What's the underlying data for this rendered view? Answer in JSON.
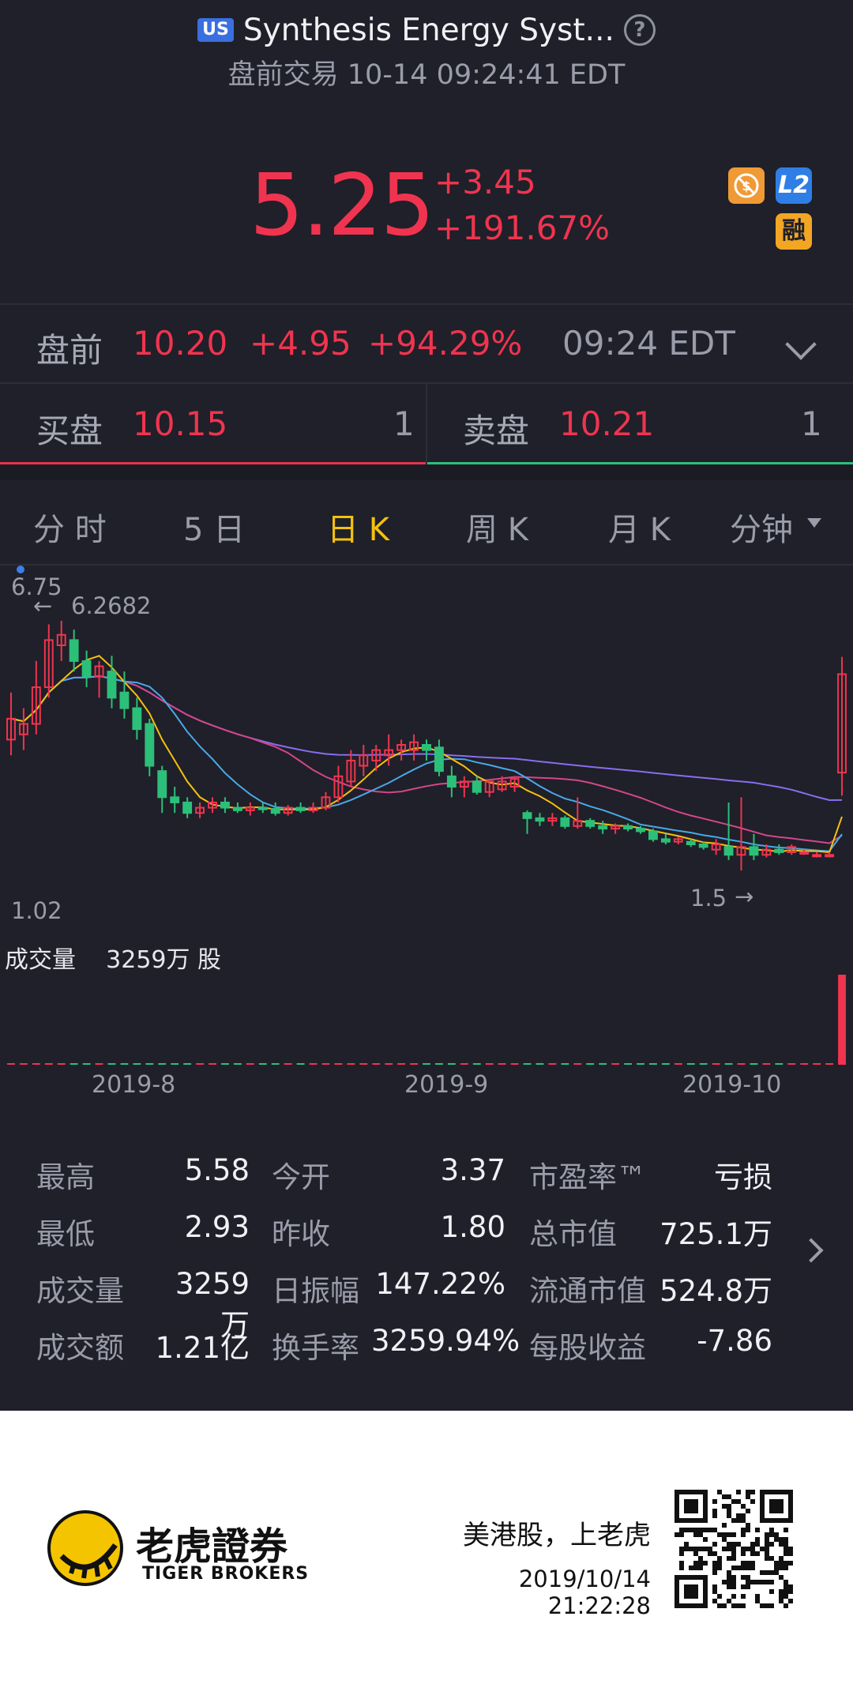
{
  "header": {
    "market_badge": "US",
    "title": "Synthesis Energy Syst...",
    "help_icon": "question-circle-icon",
    "subtitle": "盘前交易 10-14 09:24:41 EDT"
  },
  "quote": {
    "price": "5.25",
    "change": "+3.45",
    "change_pct": "+191.67%",
    "color_up": "#f0344f",
    "badges": {
      "nofee_icon": "no-commission-icon",
      "l2": "L2",
      "margin": "融"
    }
  },
  "premarket": {
    "label": "盘前",
    "price": "10.20",
    "change": "+4.95",
    "change_pct": "+94.29%",
    "time": "09:24 EDT"
  },
  "orderbook": {
    "bid_label": "买盘",
    "bid_price": "10.15",
    "bid_size": "1",
    "ask_label": "卖盘",
    "ask_price": "10.21",
    "ask_size": "1"
  },
  "tabs": [
    {
      "label": "分 时"
    },
    {
      "label": "5 日"
    },
    {
      "label": "日 K"
    },
    {
      "label": "周 K"
    },
    {
      "label": "月 K"
    },
    {
      "label": "分钟"
    }
  ],
  "active_tab": 2,
  "chart_data": {
    "type": "candlestick",
    "y_max_label": "6.75",
    "y_min_label": "1.02",
    "high_marker": "6.2682",
    "low_marker": "1.5",
    "volume_label": "成交量",
    "volume_value": "3259万 股",
    "x_labels": [
      "2019-8",
      "2019-9",
      "2019-10"
    ],
    "ylim": [
      1.02,
      6.75
    ],
    "colors": {
      "up": "#f0344f",
      "down": "#2cbf79",
      "ma5": "#f4c10e",
      "ma10": "#4aa8e8",
      "ma20": "#d5458c",
      "ma60": "#8a6cf0"
    },
    "candles": [
      {
        "o": 4.0,
        "h": 4.9,
        "l": 3.7,
        "c": 4.4
      },
      {
        "o": 4.1,
        "h": 4.6,
        "l": 3.8,
        "c": 4.3
      },
      {
        "o": 4.3,
        "h": 5.5,
        "l": 4.1,
        "c": 5.0
      },
      {
        "o": 5.0,
        "h": 6.2,
        "l": 4.8,
        "c": 5.9
      },
      {
        "o": 5.8,
        "h": 6.27,
        "l": 5.5,
        "c": 6.0
      },
      {
        "o": 5.9,
        "h": 6.1,
        "l": 5.3,
        "c": 5.5
      },
      {
        "o": 5.5,
        "h": 5.7,
        "l": 5.0,
        "c": 5.2
      },
      {
        "o": 5.2,
        "h": 5.5,
        "l": 4.8,
        "c": 5.4
      },
      {
        "o": 5.3,
        "h": 5.6,
        "l": 4.6,
        "c": 4.8
      },
      {
        "o": 4.9,
        "h": 5.3,
        "l": 4.4,
        "c": 4.6
      },
      {
        "o": 4.6,
        "h": 4.8,
        "l": 4.0,
        "c": 4.2
      },
      {
        "o": 4.3,
        "h": 4.4,
        "l": 3.3,
        "c": 3.5
      },
      {
        "o": 3.4,
        "h": 3.5,
        "l": 2.6,
        "c": 2.9
      },
      {
        "o": 2.9,
        "h": 3.1,
        "l": 2.6,
        "c": 2.8
      },
      {
        "o": 2.8,
        "h": 2.9,
        "l": 2.5,
        "c": 2.6
      },
      {
        "o": 2.6,
        "h": 2.8,
        "l": 2.5,
        "c": 2.7
      },
      {
        "o": 2.7,
        "h": 2.9,
        "l": 2.6,
        "c": 2.8
      },
      {
        "o": 2.8,
        "h": 2.9,
        "l": 2.6,
        "c": 2.7
      },
      {
        "o": 2.7,
        "h": 2.8,
        "l": 2.6,
        "c": 2.65
      },
      {
        "o": 2.65,
        "h": 2.8,
        "l": 2.55,
        "c": 2.7
      },
      {
        "o": 2.7,
        "h": 2.8,
        "l": 2.6,
        "c": 2.68
      },
      {
        "o": 2.68,
        "h": 2.8,
        "l": 2.55,
        "c": 2.6
      },
      {
        "o": 2.6,
        "h": 2.75,
        "l": 2.55,
        "c": 2.7
      },
      {
        "o": 2.7,
        "h": 2.8,
        "l": 2.6,
        "c": 2.65
      },
      {
        "o": 2.65,
        "h": 2.8,
        "l": 2.6,
        "c": 2.7
      },
      {
        "o": 2.7,
        "h": 3.0,
        "l": 2.65,
        "c": 2.9
      },
      {
        "o": 2.9,
        "h": 3.5,
        "l": 2.8,
        "c": 3.3
      },
      {
        "o": 3.2,
        "h": 3.8,
        "l": 3.1,
        "c": 3.6
      },
      {
        "o": 3.5,
        "h": 3.9,
        "l": 3.3,
        "c": 3.7
      },
      {
        "o": 3.6,
        "h": 3.9,
        "l": 3.4,
        "c": 3.8
      },
      {
        "o": 3.7,
        "h": 4.1,
        "l": 3.5,
        "c": 3.8
      },
      {
        "o": 3.8,
        "h": 4.0,
        "l": 3.6,
        "c": 3.9
      },
      {
        "o": 3.8,
        "h": 4.1,
        "l": 3.6,
        "c": 3.95
      },
      {
        "o": 3.9,
        "h": 4.0,
        "l": 3.6,
        "c": 3.8
      },
      {
        "o": 3.85,
        "h": 4.0,
        "l": 3.3,
        "c": 3.4
      },
      {
        "o": 3.3,
        "h": 3.5,
        "l": 2.9,
        "c": 3.1
      },
      {
        "o": 3.1,
        "h": 3.3,
        "l": 2.9,
        "c": 3.2
      },
      {
        "o": 3.2,
        "h": 3.3,
        "l": 2.95,
        "c": 3.0
      },
      {
        "o": 3.0,
        "h": 3.25,
        "l": 2.9,
        "c": 3.2
      },
      {
        "o": 3.05,
        "h": 3.3,
        "l": 3.0,
        "c": 3.2
      },
      {
        "o": 3.1,
        "h": 3.3,
        "l": 3.0,
        "c": 3.25
      },
      {
        "o": 2.6,
        "h": 2.65,
        "l": 2.2,
        "c": 2.5
      },
      {
        "o": 2.5,
        "h": 2.6,
        "l": 2.35,
        "c": 2.45
      },
      {
        "o": 2.45,
        "h": 2.6,
        "l": 2.35,
        "c": 2.5
      },
      {
        "o": 2.5,
        "h": 2.55,
        "l": 2.3,
        "c": 2.35
      },
      {
        "o": 2.35,
        "h": 2.9,
        "l": 2.3,
        "c": 2.45
      },
      {
        "o": 2.45,
        "h": 2.5,
        "l": 2.3,
        "c": 2.35
      },
      {
        "o": 2.35,
        "h": 2.45,
        "l": 2.2,
        "c": 2.3
      },
      {
        "o": 2.3,
        "h": 2.4,
        "l": 2.2,
        "c": 2.35
      },
      {
        "o": 2.35,
        "h": 2.4,
        "l": 2.25,
        "c": 2.3
      },
      {
        "o": 2.3,
        "h": 2.35,
        "l": 2.2,
        "c": 2.25
      },
      {
        "o": 2.25,
        "h": 2.3,
        "l": 2.05,
        "c": 2.1
      },
      {
        "o": 2.1,
        "h": 2.2,
        "l": 2.0,
        "c": 2.05
      },
      {
        "o": 2.05,
        "h": 2.15,
        "l": 2.0,
        "c": 2.1
      },
      {
        "o": 2.05,
        "h": 2.1,
        "l": 1.95,
        "c": 2.0
      },
      {
        "o": 2.0,
        "h": 2.05,
        "l": 1.9,
        "c": 1.95
      },
      {
        "o": 1.9,
        "h": 2.1,
        "l": 1.8,
        "c": 2.0
      },
      {
        "o": 1.95,
        "h": 2.8,
        "l": 1.7,
        "c": 1.8
      },
      {
        "o": 1.8,
        "h": 2.9,
        "l": 1.5,
        "c": 1.95
      },
      {
        "o": 1.95,
        "h": 2.2,
        "l": 1.7,
        "c": 1.8
      },
      {
        "o": 1.8,
        "h": 2.0,
        "l": 1.75,
        "c": 1.9
      },
      {
        "o": 1.9,
        "h": 2.0,
        "l": 1.8,
        "c": 1.85
      },
      {
        "o": 1.85,
        "h": 2.0,
        "l": 1.8,
        "c": 1.95
      },
      {
        "o": 1.85,
        "h": 1.9,
        "l": 1.8,
        "c": 1.85
      },
      {
        "o": 1.8,
        "h": 1.85,
        "l": 1.75,
        "c": 1.8
      },
      {
        "o": 1.78,
        "h": 1.85,
        "l": 1.75,
        "c": 1.8
      },
      {
        "o": 3.37,
        "h": 5.58,
        "l": 2.93,
        "c": 5.25
      }
    ]
  },
  "stats": [
    [
      {
        "label": "最高",
        "value": "5.58"
      },
      {
        "label": "今开",
        "value": "3.37"
      },
      {
        "label": "市盈率™",
        "value": "亏损"
      }
    ],
    [
      {
        "label": "最低",
        "value": "2.93"
      },
      {
        "label": "昨收",
        "value": "1.80"
      },
      {
        "label": "总市值",
        "value": "725.1万"
      }
    ],
    [
      {
        "label": "成交量",
        "value": "3259万"
      },
      {
        "label": "日振幅",
        "value": "147.22%"
      },
      {
        "label": "流通市值",
        "value": "524.8万"
      }
    ],
    [
      {
        "label": "成交额",
        "value": "1.21亿"
      },
      {
        "label": "换手率",
        "value": "3259.94%"
      },
      {
        "label": "每股收益",
        "value": "-7.86"
      }
    ]
  ],
  "footer": {
    "brand_cn": "老虎證券",
    "brand_en": "TIGER BROKERS",
    "slogan": "美港股，上老虎",
    "timestamp": "2019/10/14 21:22:28",
    "logo_icon": "tiger-logo-icon",
    "qr_icon": "qr-code-icon"
  }
}
